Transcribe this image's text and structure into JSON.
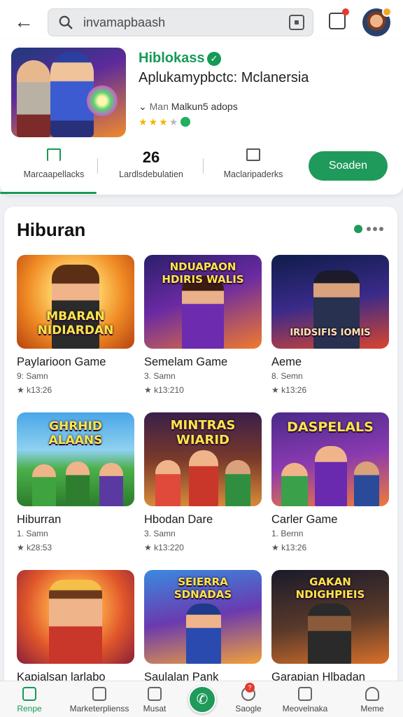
{
  "header": {
    "search_query": "invamapbaash"
  },
  "app": {
    "title": "Hiblokass",
    "subtitle": "Aplukamypbctc: Mclanersia",
    "meta_prefix": "Man",
    "meta": "Malkun5 adops",
    "rating_stars": 3,
    "stats": [
      {
        "value": "",
        "label": "Marcaapellacks",
        "icon": "bookmark-icon"
      },
      {
        "value": "26",
        "label": "Lardlsdebulatien",
        "icon": ""
      },
      {
        "value": "",
        "label": "Maclaripaderks",
        "icon": "mail-icon"
      }
    ],
    "cta_label": "Soaden"
  },
  "section": {
    "title": "Hiburan",
    "games": [
      {
        "name": "Paylarioon Game",
        "sub": "9: Samn",
        "rating": "★ k13:26",
        "cap": "MBARAN NIDIARDAN"
      },
      {
        "name": "Semelam Game",
        "sub": "3. Samn",
        "rating": "★ k13:210",
        "cap": "NDUAPAON HDIRIS WALIS"
      },
      {
        "name": "Aeme",
        "sub": "8. Semn",
        "rating": "★ k13:26",
        "cap": "IRIDSIFIS IOMIS"
      },
      {
        "name": "Hiburran",
        "sub": "1. Samn",
        "rating": "★ k28:53",
        "cap": "GHRHID ALAANS"
      },
      {
        "name": "Hbodan Dare",
        "sub": "3. Samn",
        "rating": "★ k13:220",
        "cap": "MINTRAS WIARID"
      },
      {
        "name": "Carler Game",
        "sub": "1. Bernn",
        "rating": "★ k13:26",
        "cap": "DASPELALS"
      },
      {
        "name": "Kapialsan larlabo",
        "sub": "",
        "rating": "",
        "cap": ""
      },
      {
        "name": "Saulalan Pank",
        "sub": "",
        "rating": "",
        "cap": "SEIERRA SDNADAS"
      },
      {
        "name": "Garapian Hlbadan",
        "sub": "",
        "rating": "",
        "cap": "GAKAN NDIGHPIEIS"
      }
    ]
  },
  "bottom_nav": [
    {
      "label": "Renpe",
      "icon": "home-icon",
      "active": true
    },
    {
      "label": "Marketerplienss",
      "icon": "store-icon"
    },
    {
      "label": "Musat",
      "icon": "book-icon"
    },
    {
      "label": "",
      "icon": "phone-icon"
    },
    {
      "label": "Saogle",
      "icon": "games-icon",
      "badge": "?"
    },
    {
      "label": "Meovelnaka",
      "icon": "mail-icon"
    },
    {
      "label": "Meme",
      "icon": "person-icon"
    }
  ],
  "colors": {
    "accent": "#159a56",
    "cta": "#1f9a5a",
    "badge": "#e33b2f",
    "star": "#f2b600"
  }
}
